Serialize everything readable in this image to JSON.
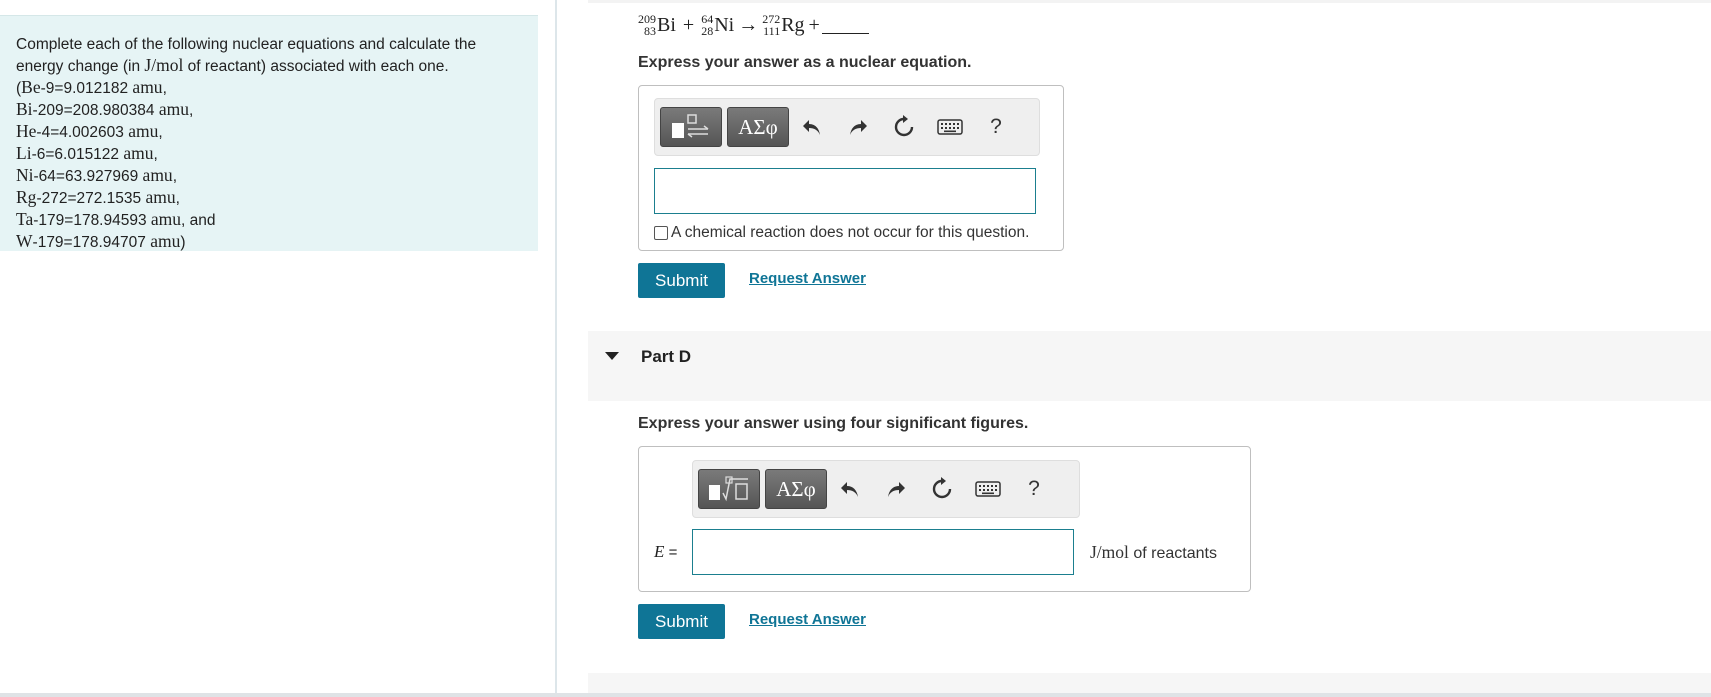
{
  "problem": {
    "intro_a": "Complete each of the following nuclear equations and calculate the",
    "intro_b": "energy change (in",
    "intro_unit": "J/mol",
    "intro_c": "of reactant) associated with each one.",
    "masses": [
      {
        "prefix": "(",
        "sym": "Be",
        "rest": "-9=9.012182",
        "unit": "amu",
        "suffix": ","
      },
      {
        "prefix": "",
        "sym": "Bi",
        "rest": "-209=208.980384",
        "unit": "amu",
        "suffix": ","
      },
      {
        "prefix": "",
        "sym": "He",
        "rest": "-4=4.002603",
        "unit": "amu",
        "suffix": ","
      },
      {
        "prefix": "",
        "sym": "Li",
        "rest": "-6=6.015122",
        "unit": "amu",
        "suffix": ","
      },
      {
        "prefix": "",
        "sym": "Ni",
        "rest": "-64=63.927969",
        "unit": "amu",
        "suffix": ","
      },
      {
        "prefix": "",
        "sym": "Rg",
        "rest": "-272=272.1535",
        "unit": "amu",
        "suffix": ","
      },
      {
        "prefix": "",
        "sym": "Ta",
        "rest": "-179=178.94593",
        "unit": "amu",
        "suffix": ", and"
      },
      {
        "prefix": "",
        "sym": "W",
        "rest": "-179=178.94707",
        "unit": "amu",
        "suffix": ")"
      }
    ]
  },
  "equation": {
    "n1_mass": "209",
    "n1_atomic": "83",
    "n1_sym": "Bi",
    "plus1": "+",
    "n2_mass": "64",
    "n2_atomic": "28",
    "n2_sym": "Ni",
    "arrow": "→",
    "n3_mass": "272",
    "n3_atomic": "111",
    "n3_sym": "Rg",
    "plus2": "+"
  },
  "part_c": {
    "instruction": "Express your answer as a nuclear equation.",
    "checkbox_label": "A chemical reaction does not occur for this question.",
    "submit_label": "Submit",
    "request_label": "Request Answer"
  },
  "part_d": {
    "title": "Part D",
    "instruction": "Express your answer using four significant figures.",
    "var_label": "E",
    "equals": "=",
    "unit": "J/mol",
    "unit_suffix": "of reactants",
    "submit_label": "Submit",
    "request_label": "Request Answer"
  },
  "toolbar": {
    "greek_label": "ΑΣφ",
    "help_label": "?"
  }
}
